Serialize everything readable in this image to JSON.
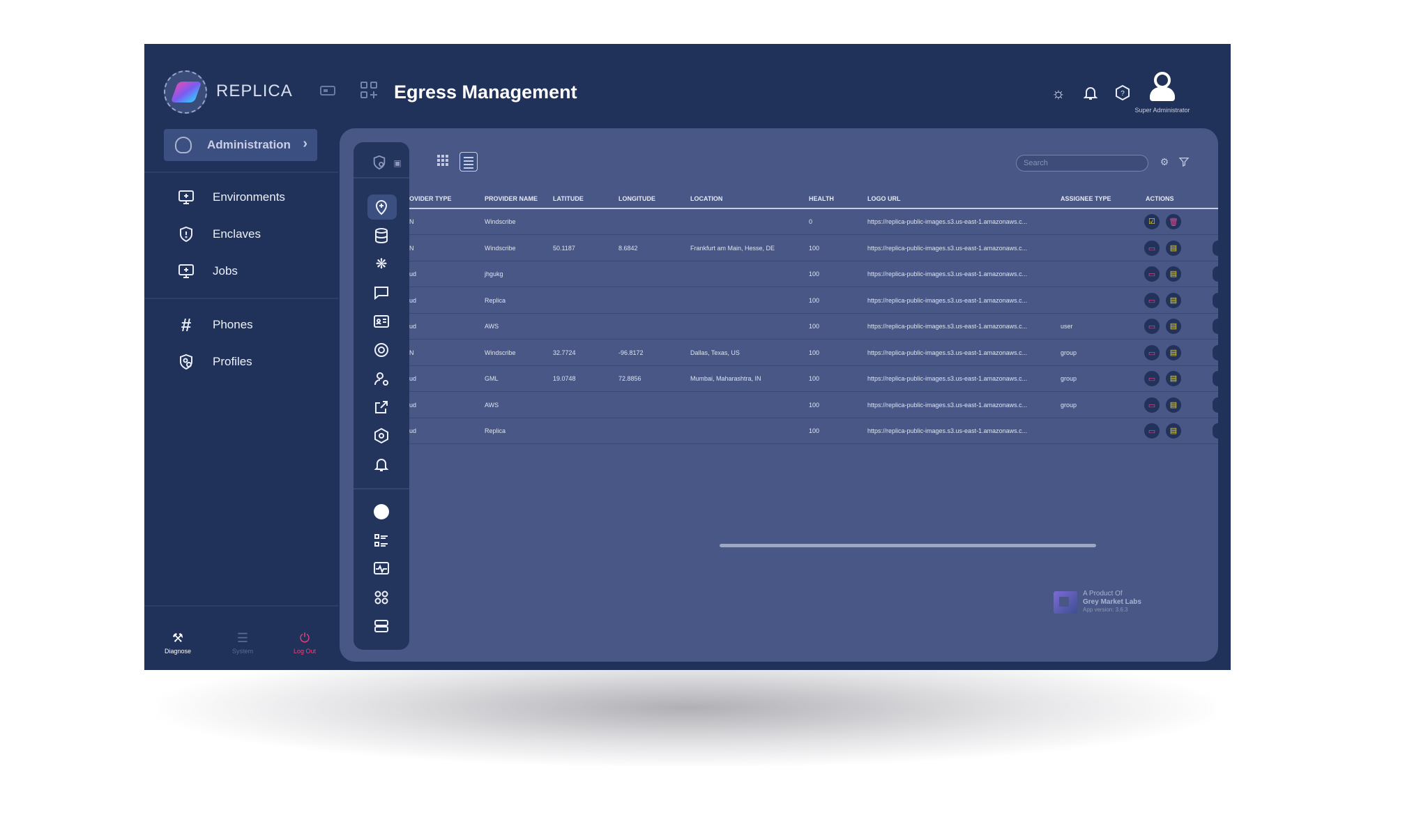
{
  "app": {
    "brand": "REPLICA",
    "page_title": "Egress Management",
    "user_role": "Super Administrator"
  },
  "sidebar": {
    "section_button": "Administration",
    "items": [
      {
        "label": "Environments",
        "icon": "monitor-plus-icon"
      },
      {
        "label": "Enclaves",
        "icon": "shield-icon"
      },
      {
        "label": "Jobs",
        "icon": "monitor-job-icon"
      },
      {
        "label": "Phones",
        "icon": "hash-icon"
      },
      {
        "label": "Profiles",
        "icon": "profile-shield-icon"
      }
    ],
    "footer": [
      {
        "label": "Diagnose",
        "icon": "tools-icon",
        "color": "#ffffff"
      },
      {
        "label": "System",
        "icon": "server-icon",
        "color": "#5d6a92"
      },
      {
        "label": "Log Out",
        "icon": "logout-icon",
        "color": "#e8437f"
      }
    ]
  },
  "toolbar": {
    "search_placeholder": "Search"
  },
  "table": {
    "headers": [
      "OVIDER TYPE",
      "PROVIDER NAME",
      "LATITUDE",
      "LONGITUDE",
      "LOCATION",
      "HEALTH",
      "LOGO URL",
      "ASSIGNEE TYPE",
      "ACTIONS"
    ],
    "rows": [
      {
        "type": "N",
        "name": "Windscribe",
        "lat": "",
        "lon": "",
        "location": "",
        "health": "0",
        "logo": "https://replica-public-images.s3.us-east-1.amazonaws.c...",
        "assignee": ""
      },
      {
        "type": "N",
        "name": "Windscribe",
        "lat": "50.1187",
        "lon": "8.6842",
        "location": "Frankfurt am Main, Hesse, DE",
        "health": "100",
        "logo": "https://replica-public-images.s3.us-east-1.amazonaws.c...",
        "assignee": ""
      },
      {
        "type": "ud",
        "name": "jhgukg",
        "lat": "",
        "lon": "",
        "location": "",
        "health": "100",
        "logo": "https://replica-public-images.s3.us-east-1.amazonaws.c...",
        "assignee": ""
      },
      {
        "type": "ud",
        "name": "Replica",
        "lat": "",
        "lon": "",
        "location": "",
        "health": "100",
        "logo": "https://replica-public-images.s3.us-east-1.amazonaws.c...",
        "assignee": ""
      },
      {
        "type": "ud",
        "name": "AWS",
        "lat": "",
        "lon": "",
        "location": "",
        "health": "100",
        "logo": "https://replica-public-images.s3.us-east-1.amazonaws.c...",
        "assignee": "user"
      },
      {
        "type": "N",
        "name": "Windscribe",
        "lat": "32.7724",
        "lon": "-96.8172",
        "location": "Dallas, Texas, US",
        "health": "100",
        "logo": "https://replica-public-images.s3.us-east-1.amazonaws.c...",
        "assignee": "group"
      },
      {
        "type": "ud",
        "name": "GML",
        "lat": "19.0748",
        "lon": "72.8856",
        "location": "Mumbai, Maharashtra, IN",
        "health": "100",
        "logo": "https://replica-public-images.s3.us-east-1.amazonaws.c...",
        "assignee": "group"
      },
      {
        "type": "ud",
        "name": "AWS",
        "lat": "",
        "lon": "",
        "location": "",
        "health": "100",
        "logo": "https://replica-public-images.s3.us-east-1.amazonaws.c...",
        "assignee": "group"
      },
      {
        "type": "ud",
        "name": "Replica",
        "lat": "",
        "lon": "",
        "location": "",
        "health": "100",
        "logo": "https://replica-public-images.s3.us-east-1.amazonaws.c...",
        "assignee": ""
      }
    ]
  },
  "footer_brand": {
    "line1": "A Product Of",
    "line2": "Grey Market Labs",
    "line3": "App version: 3.6.3"
  },
  "colors": {
    "app_bg": "#203259",
    "panel_bg": "#485786",
    "accent_red": "#e84a8c",
    "accent_yellow": "#e3d03a"
  }
}
